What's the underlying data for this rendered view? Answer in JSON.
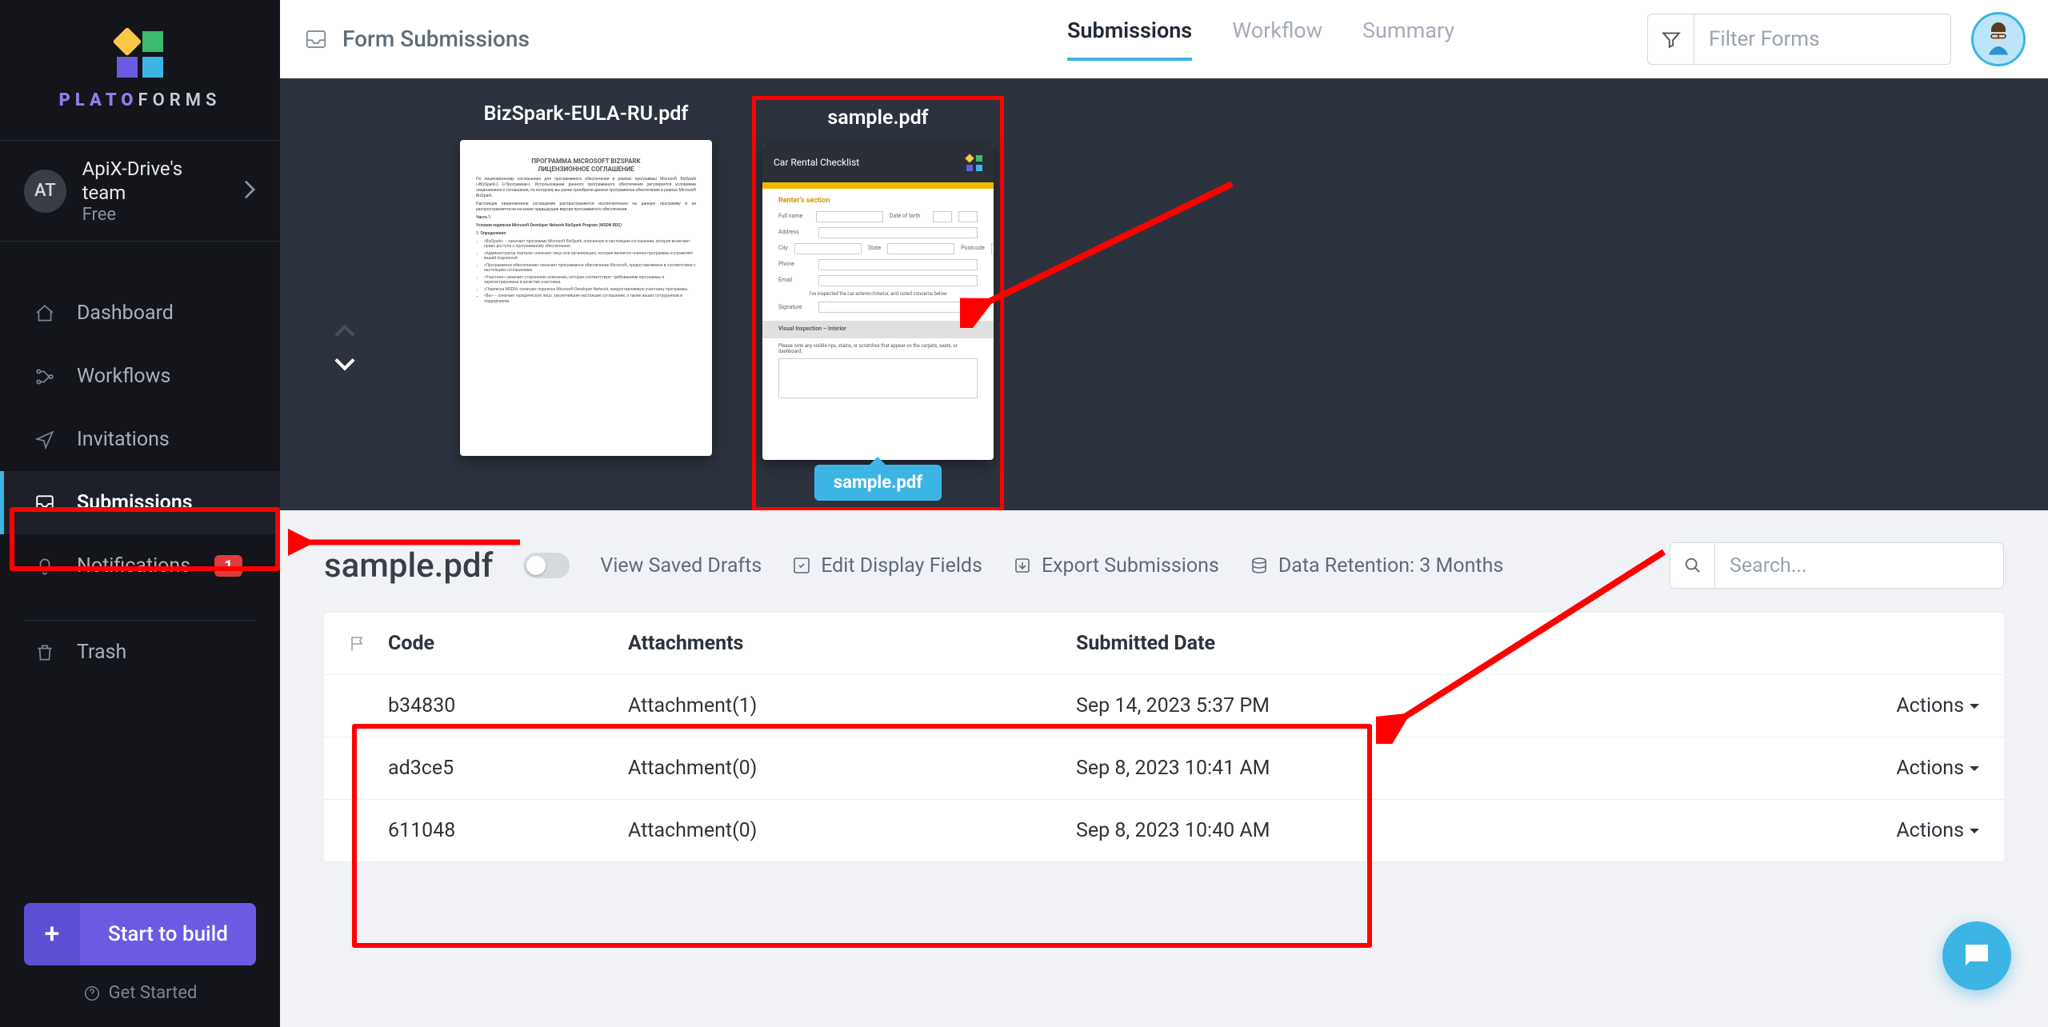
{
  "brand": {
    "name_left": "PLATO",
    "name_right": "FORMS"
  },
  "account": {
    "initials": "AT",
    "name": "ApiX-Drive's team",
    "plan": "Free"
  },
  "sidebar": {
    "items": [
      {
        "label": "Dashboard",
        "icon": "home-icon"
      },
      {
        "label": "Workflows",
        "icon": "workflow-icon"
      },
      {
        "label": "Invitations",
        "icon": "send-icon"
      },
      {
        "label": "Submissions",
        "icon": "inbox-icon",
        "active": true
      },
      {
        "label": "Notifications",
        "icon": "bell-icon",
        "badge": "1"
      },
      {
        "label": "Trash",
        "icon": "trash-icon",
        "separated": true
      }
    ],
    "start_button": "Start to build",
    "get_started": "Get Started"
  },
  "header": {
    "form_submissions": "Form Submissions",
    "tabs": [
      {
        "label": "Submissions",
        "active": true
      },
      {
        "label": "Workflow"
      },
      {
        "label": "Summary"
      }
    ],
    "filter_placeholder": "Filter Forms"
  },
  "thumbnails": [
    {
      "name": "BizSpark-EULA-RU.pdf",
      "kind": "doc"
    },
    {
      "name": "sample.pdf",
      "kind": "form",
      "selected": true,
      "chip": "sample.pdf",
      "form_title": "Car Rental Checklist",
      "section": "Renter's section",
      "fields": [
        "Full name",
        "Date of birth",
        "Address",
        "City",
        "State",
        "Postcode",
        "Phone",
        "Email",
        "Signature"
      ],
      "inspection_title": "Visual Inspection – Interior",
      "inspection_hint": "Please note any visible rips, stains, or scratches that appear on the carpets, seats, or dashboard."
    }
  ],
  "panel": {
    "title": "sample.pdf",
    "view_saved": "View Saved Drafts",
    "edit_fields": "Edit Display Fields",
    "export": "Export Submissions",
    "retention": "Data Retention: 3 Months",
    "search_placeholder": "Search...",
    "columns": {
      "code": "Code",
      "attachments": "Attachments",
      "submitted": "Submitted Date"
    },
    "actions_label": "Actions",
    "rows": [
      {
        "code": "b34830",
        "attachments": "Attachment(1)",
        "submitted": "Sep 14, 2023 5:37 PM"
      },
      {
        "code": "ad3ce5",
        "attachments": "Attachment(0)",
        "submitted": "Sep 8, 2023 10:41 AM"
      },
      {
        "code": "611048",
        "attachments": "Attachment(0)",
        "submitted": "Sep 8, 2023 10:40 AM"
      }
    ]
  }
}
